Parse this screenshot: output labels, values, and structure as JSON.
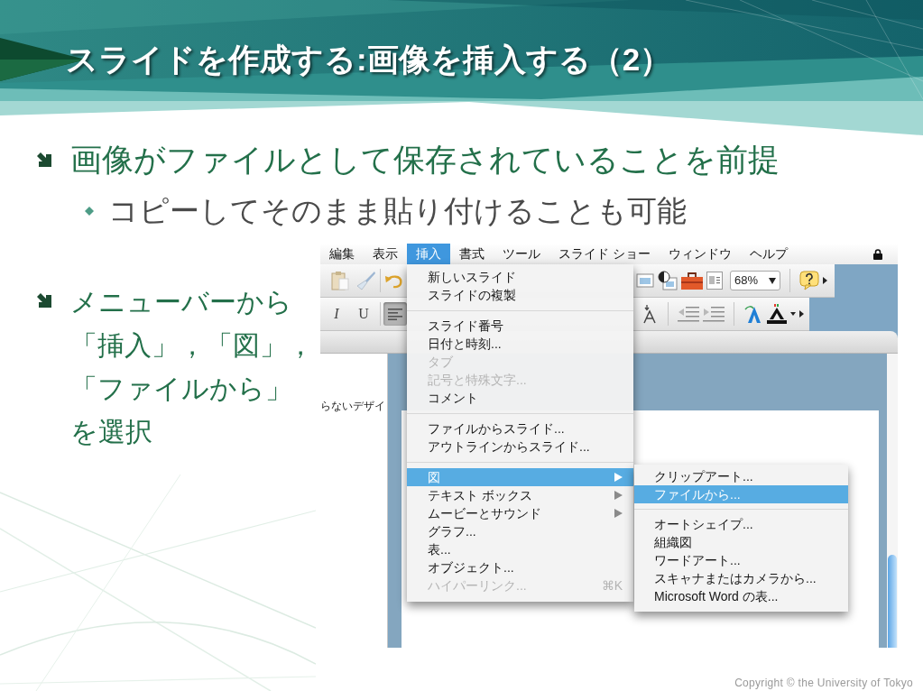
{
  "title": "スライドを作成する:画像を挿入する（2）",
  "bullets": [
    {
      "text": "画像がファイルとして保存されていることを前提",
      "children": [
        {
          "text": "コピーしてそのまま貼り付けることも可能"
        }
      ]
    }
  ],
  "side_bullet": {
    "text": "メニューバーから「挿入」，「図」，「ファイルから」を選択"
  },
  "app_screenshot": {
    "menubar": [
      {
        "label": "編集",
        "selected": false
      },
      {
        "label": "表示",
        "selected": false
      },
      {
        "label": "挿入",
        "selected": true
      },
      {
        "label": "書式",
        "selected": false
      },
      {
        "label": "ツール",
        "selected": false
      },
      {
        "label": "スライド ショー",
        "selected": false
      },
      {
        "label": "ウィンドウ",
        "selected": false
      },
      {
        "label": "ヘルプ",
        "selected": false
      }
    ],
    "toolbar": {
      "zoom": "68%",
      "format_buttons": [
        {
          "label": "I",
          "pressed": false
        },
        {
          "label": "U",
          "pressed": false
        }
      ],
      "align_left_pressed": true
    },
    "side_pane_text": "らないデザイ",
    "insert_menu": {
      "groups": [
        [
          {
            "label": "新しいスライド",
            "selected": false,
            "disabled": false,
            "submenu": false
          },
          {
            "label": "スライドの複製",
            "selected": false,
            "disabled": false,
            "submenu": false
          }
        ],
        [
          {
            "label": "スライド番号",
            "selected": false,
            "disabled": false,
            "submenu": false
          },
          {
            "label": "日付と時刻...",
            "selected": false,
            "disabled": false,
            "submenu": false
          },
          {
            "label": "タブ",
            "selected": false,
            "disabled": true,
            "submenu": false
          },
          {
            "label": "記号と特殊文字...",
            "selected": false,
            "disabled": true,
            "submenu": false
          },
          {
            "label": "コメント",
            "selected": false,
            "disabled": false,
            "submenu": false
          }
        ],
        [
          {
            "label": "ファイルからスライド...",
            "selected": false,
            "disabled": false,
            "submenu": false
          },
          {
            "label": "アウトラインからスライド...",
            "selected": false,
            "disabled": false,
            "submenu": false
          }
        ],
        [
          {
            "label": "図",
            "selected": true,
            "disabled": false,
            "submenu": true
          },
          {
            "label": "テキスト ボックス",
            "selected": false,
            "disabled": false,
            "submenu": true
          },
          {
            "label": "ムービーとサウンド",
            "selected": false,
            "disabled": false,
            "submenu": true
          },
          {
            "label": "グラフ...",
            "selected": false,
            "disabled": false,
            "submenu": false
          },
          {
            "label": "表...",
            "selected": false,
            "disabled": false,
            "submenu": false
          },
          {
            "label": "オブジェクト...",
            "selected": false,
            "disabled": false,
            "submenu": false
          },
          {
            "label": "ハイパーリンク...",
            "selected": false,
            "disabled": true,
            "submenu": false,
            "shortcut": "⌘K"
          }
        ]
      ]
    },
    "picture_submenu": {
      "groups": [
        [
          {
            "label": "クリップアート...",
            "selected": false,
            "disabled": false
          },
          {
            "label": "ファイルから...",
            "selected": true,
            "disabled": false
          }
        ],
        [
          {
            "label": "オートシェイプ...",
            "selected": false,
            "disabled": false
          },
          {
            "label": "組織図",
            "selected": false,
            "disabled": false
          },
          {
            "label": "ワードアート...",
            "selected": false,
            "disabled": false
          },
          {
            "label": "スキャナまたはカメラから...",
            "selected": false,
            "disabled": false
          },
          {
            "label": "Microsoft Word の表...",
            "selected": false,
            "disabled": false
          }
        ]
      ]
    }
  },
  "footer": "Copyright © the University of Tokyo"
}
